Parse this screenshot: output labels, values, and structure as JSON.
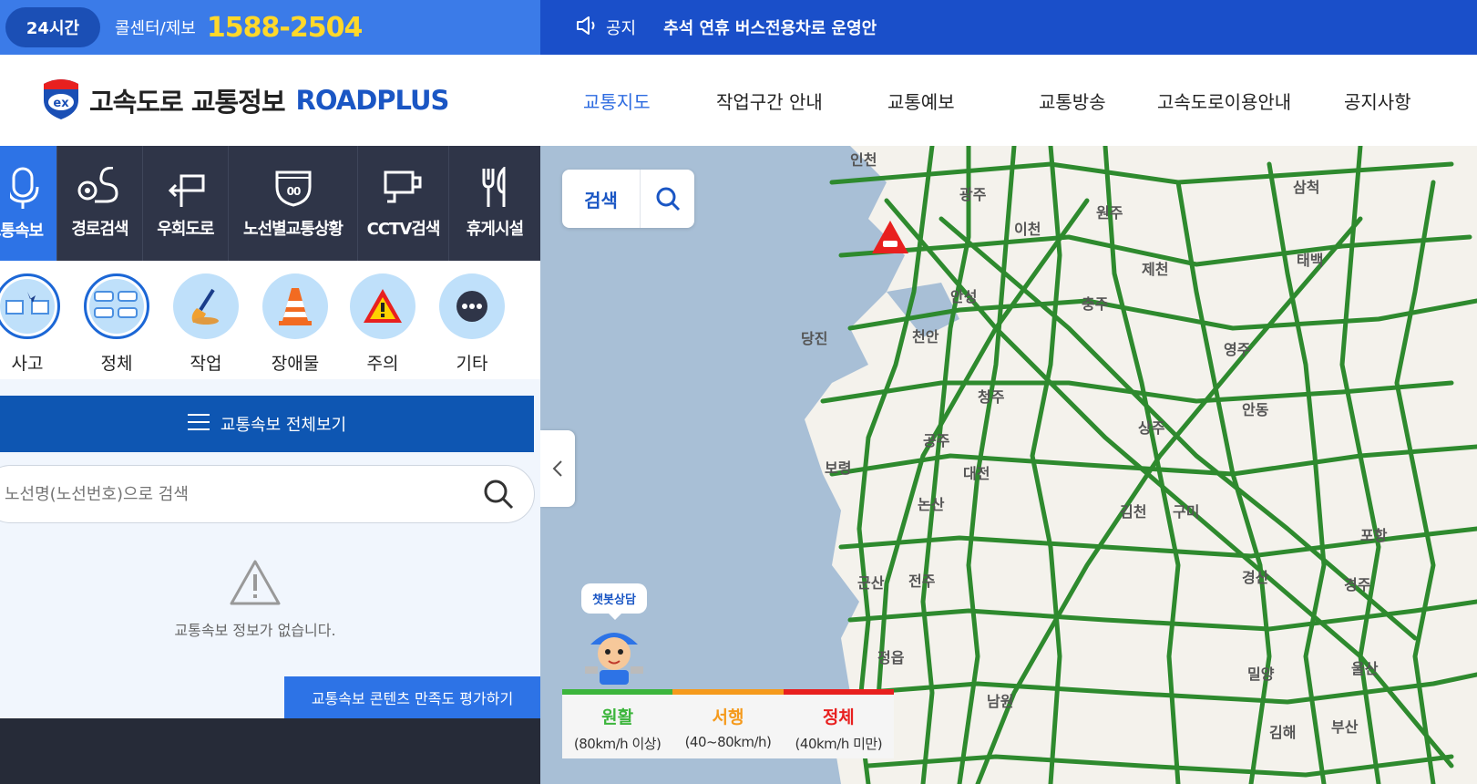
{
  "topbar": {
    "badge_24": "24시간",
    "callcenter_label": "콜센터/제보",
    "callcenter_number": "1588-2504",
    "notice_label": "공지",
    "notice_text": "추석 연휴 버스전용차로 운영안"
  },
  "header": {
    "logo_text": "고속도로 교통정보",
    "logo_brand": "ROADPLUS",
    "logo_badge": "ex",
    "nav": [
      {
        "label": "교통지도",
        "active": true
      },
      {
        "label": "작업구간 안내",
        "active": false
      },
      {
        "label": "교통예보",
        "active": false
      },
      {
        "label": "교통방송",
        "active": false
      },
      {
        "label": "고속도로이용안내",
        "active": false
      },
      {
        "label": "공지사항",
        "active": false
      }
    ]
  },
  "sidebar": {
    "tabs": [
      {
        "label": "교통속보",
        "icon": "microphone-icon",
        "active": true
      },
      {
        "label": "경로검색",
        "icon": "route-icon",
        "active": false
      },
      {
        "label": "우회도로",
        "icon": "detour-icon",
        "active": false
      },
      {
        "label": "노선별교통상황",
        "icon": "route-shield-icon",
        "active": false
      },
      {
        "label": "CCTV검색",
        "icon": "cctv-icon",
        "active": false
      },
      {
        "label": "휴게시설",
        "icon": "fork-knife-icon",
        "active": false
      }
    ],
    "categories": [
      {
        "label": "사고",
        "icon": "accident-icon",
        "selected": true
      },
      {
        "label": "정체",
        "icon": "congestion-icon",
        "selected": true
      },
      {
        "label": "작업",
        "icon": "shovel-icon",
        "selected": false
      },
      {
        "label": "장애물",
        "icon": "traffic-cone-icon",
        "selected": false
      },
      {
        "label": "주의",
        "icon": "warning-icon",
        "selected": false
      },
      {
        "label": "기타",
        "icon": "more-icon",
        "selected": false
      }
    ],
    "view_all_label": "교통속보 전체보기",
    "search_placeholder": "노선명(노선번호)으로 검색",
    "empty_message": "교통속보 정보가 없습니다.",
    "rate_button": "교통속보 콘텐츠 만족도 평가하기"
  },
  "map": {
    "search_label": "검색",
    "chatbot_label": "챗봇상담",
    "legend": [
      {
        "name": "원활",
        "range": "(80km/h 이상)",
        "color": "#3cb53c"
      },
      {
        "name": "서행",
        "range": "(40~80km/h)",
        "color": "#f59a1c"
      },
      {
        "name": "정체",
        "range": "(40km/h 미만)",
        "color": "#e8201f"
      }
    ],
    "cities": [
      "인천",
      "광주",
      "원주",
      "삼척",
      "이천",
      "제천",
      "태백",
      "안성",
      "충주",
      "당진",
      "천안",
      "영주",
      "청주",
      "안동",
      "상주",
      "보령",
      "공주",
      "대전",
      "논산",
      "김천",
      "구미",
      "포항",
      "군산",
      "전주",
      "경산",
      "경주",
      "정읍",
      "밀양",
      "울산",
      "남원",
      "김해",
      "부산"
    ],
    "colors": {
      "sea": "#a8bfd6",
      "land": "#f4f2ec",
      "highway": "#2e8a2e"
    }
  }
}
